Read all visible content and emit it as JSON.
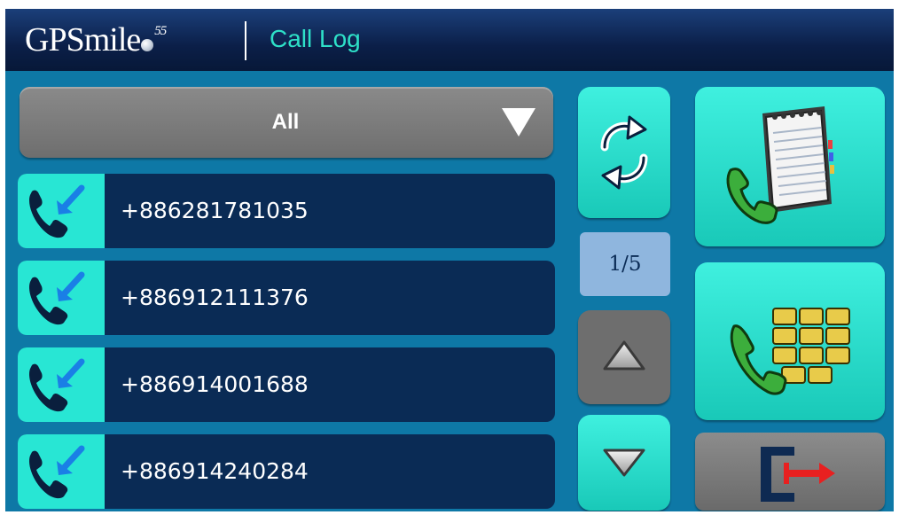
{
  "header": {
    "brand": "GPSmile",
    "brand_superscript": "55",
    "title": "Call Log"
  },
  "filter": {
    "selected": "All"
  },
  "calls": [
    {
      "number": "+886281781035",
      "icon": "incoming-call-icon"
    },
    {
      "number": "+886912111376",
      "icon": "incoming-call-icon"
    },
    {
      "number": "+886914001688",
      "icon": "incoming-call-icon"
    },
    {
      "number": "+886914240284",
      "icon": "incoming-call-icon"
    }
  ],
  "pagination": {
    "indicator": "1/5"
  },
  "icons": {
    "refresh": "refresh-icon",
    "up": "up-arrow-icon",
    "down": "down-arrow-icon",
    "contacts": "contacts-phonebook-icon",
    "dialpad": "dialpad-icon",
    "exit": "exit-icon"
  },
  "colors": {
    "background": "#0e78a6",
    "header": "#0b1f48",
    "row": "#0a2b55",
    "accent": "#28e6d4",
    "title": "#2ee0c8",
    "disabled": "#6e6e6e"
  }
}
